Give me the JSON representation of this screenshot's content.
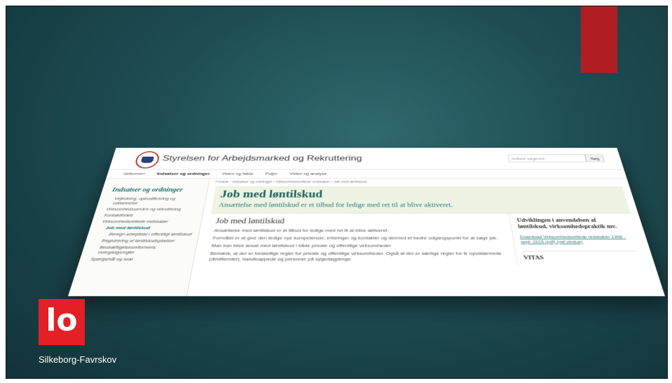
{
  "site": {
    "title": "Styrelsen for Arbejdsmarked og Rekruttering",
    "search_placeholder": "Indtast søgeord",
    "search_button": "Søg"
  },
  "topnav": [
    "Velkomen",
    "Indsatser og ordninger",
    "Viden og fakta",
    "Puljer",
    "Viden og analyse"
  ],
  "breadcrumb": "Forside › Indsatser og ordninger › Virksomhedsrettede redskaber › Job med løntilskud",
  "sidebar": {
    "heading": "Indsatser og ordninger",
    "items": [
      "Vejledning, opkvalificering og uddannelse",
      "Virksomhedsservice og rekruttering",
      "Kontaktforløb",
      "Virksomhedsrettede redskaber",
      "Job med løntilskud",
      "Beregn arbejdstid i offentligt løntilskud",
      "Registrering af løntilskudspladser",
      "Beskæftigelsesreformens overgangsregler",
      "Spørgsmål og svar"
    ]
  },
  "hero": {
    "title": "Job med løntilskud",
    "subtitle": "Ansættelse med løntilskud er et tilbud for ledige med ret til at blive aktiveret."
  },
  "article": {
    "title": "Job med løntilskud",
    "paragraphs": [
      "Ansættelse med løntilskud er et tilbud for ledige med ret til at blive aktiveret.",
      "Formålet er at give den ledige nye kompetencer, erfaringer og kontakter og dermed et bedre udgangspunkt for at søge job.",
      "Man kan blive ansat med løntilskud i både private og offentlige virksomheder.",
      "Bemærk, at der er forskellige regler for private og offentlige virksomheder. Også at der er særlige regler for fx nyuddannede (dimittender), handicappede og personer på sygedagpenge."
    ]
  },
  "aside": {
    "heading": "Udviklingen i anvendelsen af løntilskud, virksomhedspraktik mv.",
    "link": "Download Virksomhedsrettede redskaber 1998 - sept. 2015 (pdf) (nyt vindue)",
    "subheading": "VITAS"
  },
  "logo": {
    "glyph": "lo",
    "org_name": "Silkeborg-Favrskov"
  },
  "colors": {
    "accent_red": "#b01e23",
    "logo_red": "#e41f26",
    "background_teal": "#1d4c52",
    "site_teal": "#1a6161"
  }
}
